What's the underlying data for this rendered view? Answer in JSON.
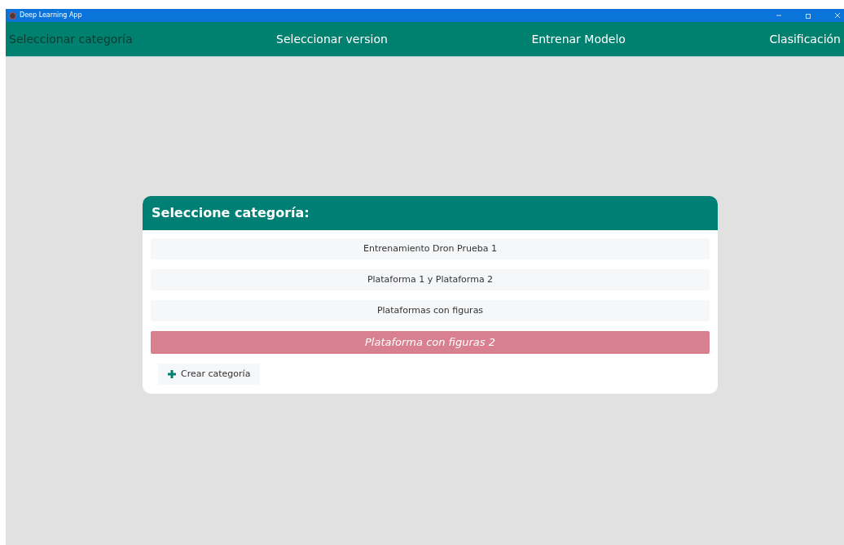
{
  "window": {
    "title": "Deep Learning App"
  },
  "nav": [
    {
      "label": "Seleccionar categoría",
      "selected": true
    },
    {
      "label": "Seleccionar version",
      "selected": false
    },
    {
      "label": "Entrenar Modelo",
      "selected": false
    },
    {
      "label": "Clasificación",
      "selected": false
    }
  ],
  "panel": {
    "title": "Seleccione categoría:",
    "categories": [
      {
        "label": "Entrenamiento Dron Prueba 1",
        "selected": false
      },
      {
        "label": "Plataforma 1 y Plataforma 2",
        "selected": false
      },
      {
        "label": "Plataformas con figuras",
        "selected": false
      },
      {
        "label": "Plataforma con figuras 2",
        "selected": true
      }
    ],
    "create_button": "Crear categoría"
  }
}
